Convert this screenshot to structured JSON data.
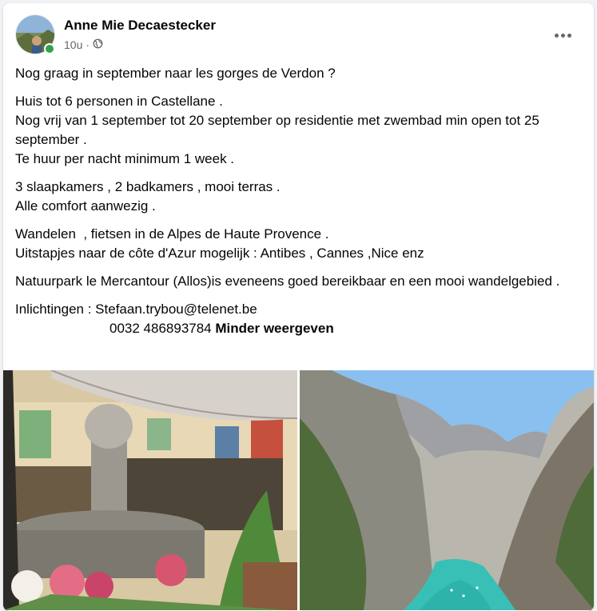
{
  "post": {
    "author": "Anne Mie Decaestecker",
    "time": "10u",
    "separator": "·",
    "visibility_icon": "globe-icon",
    "more_icon": "more-horizontal-icon",
    "paragraphs": [
      [
        "Nog graag in september naar les gorges de Verdon ?"
      ],
      [
        "Huis tot 6 personen in Castellane .",
        "Nog vrij van 1 september tot 20 september op residentie met zwembad min open tot 25 september .",
        "Te huur per nacht minimum 1 week ."
      ],
      [
        "3 slaapkamers , 2 badkamers , mooi terras .",
        "Alle comfort aanwezig ."
      ],
      [
        "Wandelen  , fietsen in de Alpes de Haute Provence .",
        "Uitstapjes naar de côte d'Azur mogelijk : Antibes , Cannes ,Nice enz"
      ],
      [
        "Natuurpark le Mercantour (Allos)is eveneens goed bereikbaar en een mooi wandelgebied ."
      ]
    ],
    "contact_line": "Inlichtingen : Stefaan.trybou@telenet.be",
    "phone": "0032 486893784",
    "see_less": "Minder weergeven"
  },
  "colors": {
    "online": "#31a24c",
    "text": "#050505",
    "secondary": "#65676b"
  }
}
